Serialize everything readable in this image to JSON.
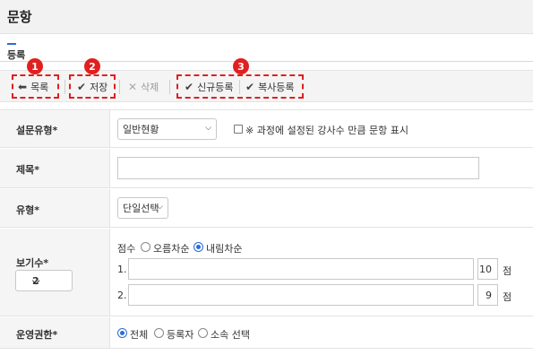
{
  "page": {
    "title": "문항",
    "section_tab": "등록"
  },
  "toolbar": {
    "list_label": "목록",
    "save_label": "저장",
    "delete_label": "삭제",
    "new_register_label": "신규등록",
    "copy_register_label": "복사등록"
  },
  "annotations": [
    "1",
    "2",
    "3"
  ],
  "form": {
    "survey_type": {
      "label": "설문유형*",
      "selected": "일반현황",
      "checkbox_label": "※ 과정에 설정된 강사수 만큼 문항 표시",
      "checkbox_checked": false
    },
    "subject": {
      "label": "제목*",
      "value": ""
    },
    "type": {
      "label": "유형*",
      "selected": "단일선택"
    },
    "options": {
      "label": "보기수*",
      "count_selected": "2",
      "score_label": "점수",
      "order_options": [
        "오름차순",
        "내림차순"
      ],
      "order_selected": "내림차순",
      "items": [
        {
          "num": "1.",
          "text": "",
          "score": "10",
          "unit": "점"
        },
        {
          "num": "2.",
          "text": "",
          "score": "9",
          "unit": "점"
        }
      ]
    },
    "permission": {
      "label": "운영권한*",
      "choices": [
        "전체",
        "등록자",
        "소속 선택"
      ],
      "selected": "전체"
    }
  },
  "colors": {
    "accent": "#2b6cd6",
    "annotation": "#e02020"
  }
}
